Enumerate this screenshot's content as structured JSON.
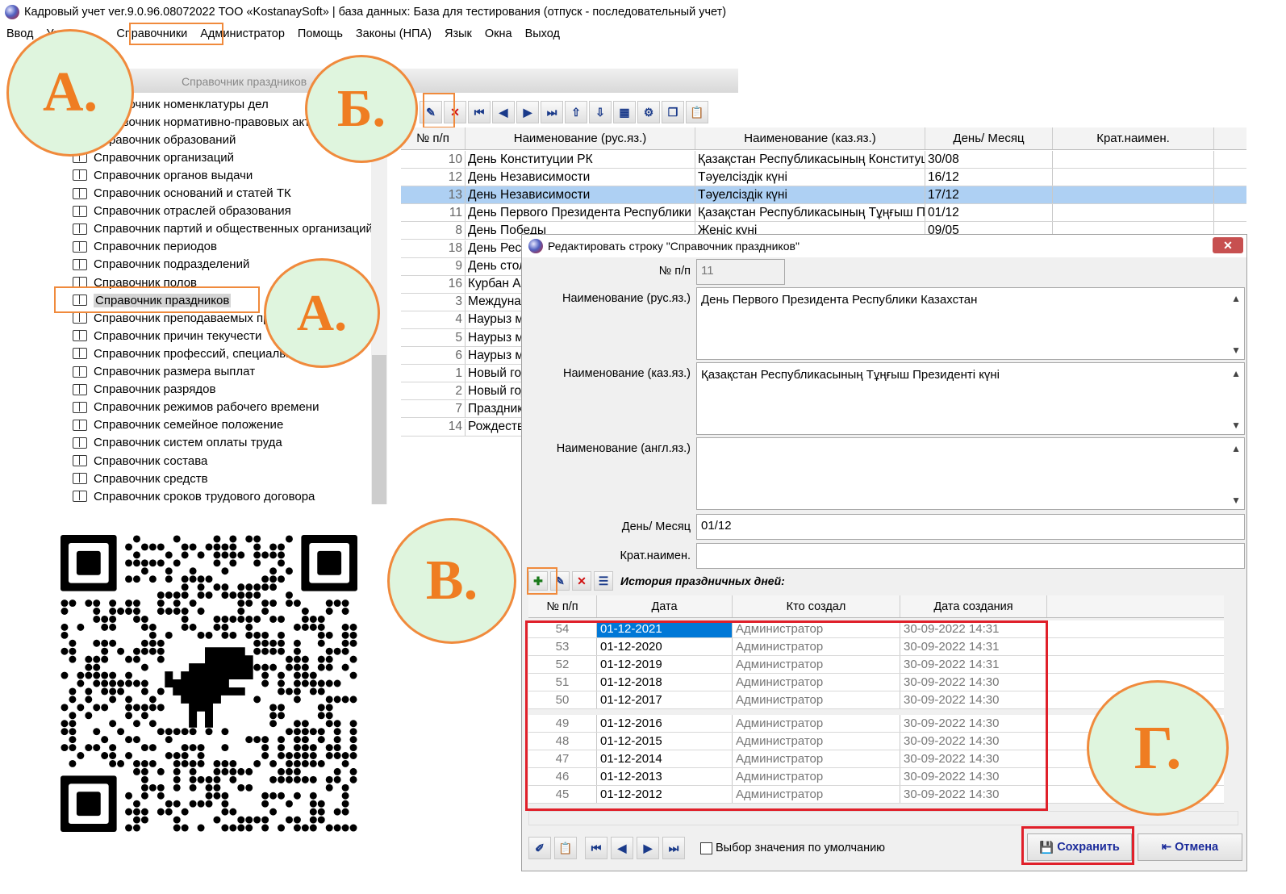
{
  "window": {
    "title": "Кадровый учет ver.9.0.96.08072022 ТОО «KostanaySoft» | база данных: База для тестирования (отпуск - последовательный учет)"
  },
  "menu": [
    "Ввод",
    "Учет",
    "Справочники",
    "Администратор",
    "Помощь",
    "Законы (НПА)",
    "Язык",
    "Окна",
    "Выход"
  ],
  "tree": {
    "header": "Справочник праздников",
    "items": [
      "Справочник номенклатуры дел",
      "Справочник нормативно-правовых актов",
      "Справочник образований",
      "Справочник организаций",
      "Справочник органов выдачи",
      "Справочник оснований и статей ТК",
      "Справочник отраслей образования",
      "Справочник партий и общественных организаций",
      "Справочник периодов",
      "Справочник подразделений",
      "Справочник полов",
      "Справочник праздников",
      "Справочник преподаваемых предметов",
      "Справочник причин текучести",
      "Справочник профессий, специальностей",
      "Справочник размера выплат",
      "Справочник разрядов",
      "Справочник режимов рабочего времени",
      "Справочник семейное положение",
      "Справочник систем оплаты труда",
      "Справочник состава",
      "Справочник средств",
      "Справочник сроков трудового договора"
    ],
    "selected_index": 11
  },
  "grid": {
    "headers": [
      "№ п/п",
      "Наименование (рус.яз.)",
      "Наименование (каз.яз.)",
      "День/ Месяц",
      "Крат.наимен."
    ],
    "rows": [
      [
        "10",
        "День Конституции РК",
        "Қазақстан Республикасының Конституциясы күні",
        "30/08",
        ""
      ],
      [
        "12",
        "День Независимости",
        "Тәуелсіздік күні",
        "16/12",
        ""
      ],
      [
        "13",
        "День Независимости",
        "Тәуелсіздік күні",
        "17/12",
        ""
      ],
      [
        "11",
        "День Первого Президента Республики Казахстан",
        "Қазақстан Республикасының Тұңғыш Президенті күні",
        "01/12",
        ""
      ],
      [
        "8",
        "День Победы",
        "Жеңіс күні",
        "09/05",
        ""
      ],
      [
        "18",
        "День Республики",
        "",
        "",
        ""
      ],
      [
        "9",
        "День столицы",
        "",
        "",
        ""
      ],
      [
        "16",
        "Курбан Айт",
        "",
        "",
        ""
      ],
      [
        "3",
        "Международный женский день",
        "",
        "",
        ""
      ],
      [
        "4",
        "Наурыз мейрамы",
        "",
        "",
        ""
      ],
      [
        "5",
        "Наурыз мейрамы",
        "",
        "",
        ""
      ],
      [
        "6",
        "Наурыз мейрамы",
        "",
        "",
        ""
      ],
      [
        "1",
        "Новый год",
        "",
        "",
        ""
      ],
      [
        "2",
        "Новый год",
        "",
        "",
        ""
      ],
      [
        "7",
        "Праздник единства народа Казахстана",
        "",
        "",
        ""
      ],
      [
        "14",
        "Рождество Христово",
        "",
        "",
        ""
      ]
    ],
    "selected_index": 2
  },
  "dialog": {
    "title": "Редактировать строку \"Справочник праздников\"",
    "labels": {
      "num": "№ п/п",
      "name_ru": "Наименование (рус.яз.)",
      "name_kz": "Наименование (каз.яз.)",
      "name_en": "Наименование (англ.яз.)",
      "day_month": "День/ Месяц",
      "short": "Крат.наимен."
    },
    "values": {
      "num": "11",
      "name_ru": "День Первого Президента Республики Казахстан",
      "name_kz": "Қазақстан Республикасының Тұңғыш Президенті күні",
      "name_en": "",
      "day_month": "01/12",
      "short": ""
    },
    "history": {
      "title": "История праздничных дней:",
      "headers": [
        "№ п/п",
        "Дата",
        "Кто создал",
        "Дата создания"
      ],
      "rows": [
        [
          "54",
          "01-12-2021",
          "Администратор",
          "30-09-2022 14:31"
        ],
        [
          "53",
          "01-12-2020",
          "Администратор",
          "30-09-2022 14:31"
        ],
        [
          "52",
          "01-12-2019",
          "Администратор",
          "30-09-2022 14:31"
        ],
        [
          "51",
          "01-12-2018",
          "Администратор",
          "30-09-2022 14:30"
        ],
        [
          "50",
          "01-12-2017",
          "Администратор",
          "30-09-2022 14:30"
        ],
        [
          "49",
          "01-12-2016",
          "Администратор",
          "30-09-2022 14:30"
        ],
        [
          "48",
          "01-12-2015",
          "Администратор",
          "30-09-2022 14:30"
        ],
        [
          "47",
          "01-12-2014",
          "Администратор",
          "30-09-2022 14:30"
        ],
        [
          "46",
          "01-12-2013",
          "Администратор",
          "30-09-2022 14:30"
        ],
        [
          "45",
          "01-12-2012",
          "Администратор",
          "30-09-2022 14:30"
        ]
      ]
    },
    "default_checkbox": "Выбор значения по умолчанию",
    "save_label": "Сохранить",
    "cancel_label": "Отмена"
  },
  "callouts": {
    "a": "А.",
    "b": "Б.",
    "v": "В.",
    "g": "Г."
  },
  "colors": {
    "highlight_orange": "#f08a3c",
    "callout_fill": "#dff5de",
    "callout_text": "#ef7d22",
    "history_frame": "#e0202a",
    "selection": "#aed0f3"
  }
}
